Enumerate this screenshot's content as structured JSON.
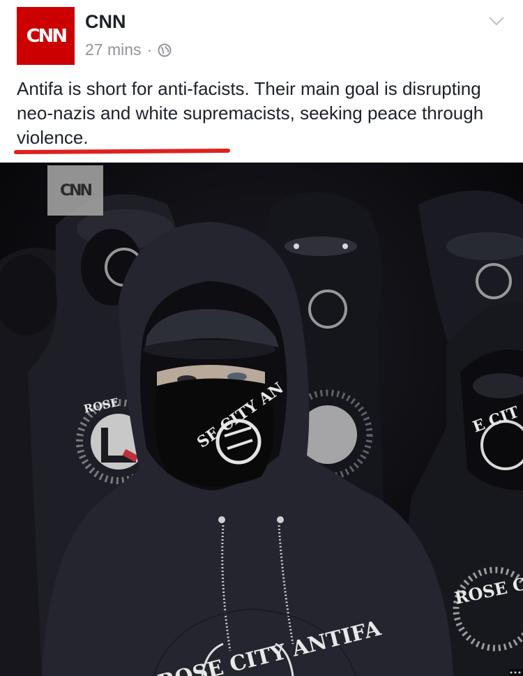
{
  "post": {
    "page_name": "CNN",
    "avatar_logo": "CNN",
    "time": "27 mins",
    "separator": "·",
    "audience_icon": "globe-icon",
    "menu_icon": "chevron-down-icon",
    "text_part1": "Antifa is short for anti-facists. Their main goal is disrupting neo-nazis and white supremacists, seeking ",
    "text_highlight": "peace through violence",
    "text_end": ".",
    "highlight_color": "#e02020"
  },
  "image": {
    "watermark": "CNN",
    "hoodie_text_main": "ROSE CITY ANTIFA",
    "mask_text": "SE CITY AN",
    "right_hoodie_text": "ROSE C",
    "right_mask_text": "E CIT",
    "left_hoodie_text": "ROSE"
  },
  "colors": {
    "brand_red": "#cc0000",
    "meta_gray": "#90949c",
    "text": "#1d2129"
  }
}
